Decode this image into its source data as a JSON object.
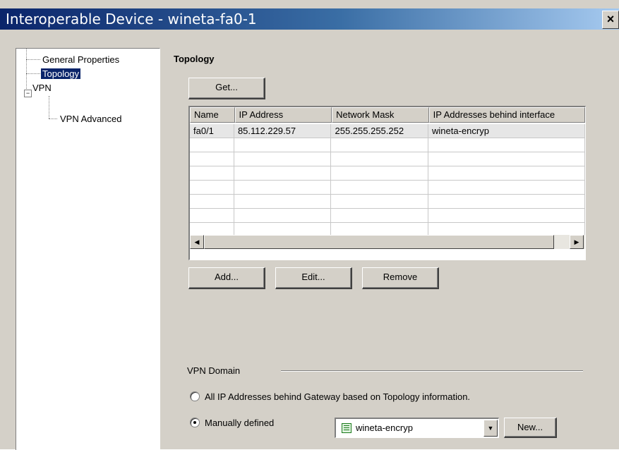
{
  "window": {
    "title": "Interoperable Device - wineta-fa0-1",
    "close_label": "×"
  },
  "tree": {
    "items": [
      {
        "label": "General Properties"
      },
      {
        "label": "Topology",
        "selected": true
      },
      {
        "label": "VPN",
        "expander": "⊟"
      },
      {
        "label": "VPN Advanced"
      }
    ]
  },
  "topology": {
    "title": "Topology",
    "get_label": "Get...",
    "columns": [
      "Name",
      "IP Address",
      "Network Mask",
      "IP Addresses behind interface"
    ],
    "rows": [
      [
        "fa0/1",
        "85.112.229.57",
        "255.255.255.252",
        "wineta-encryp"
      ]
    ],
    "scroll_left": "◀",
    "scroll_right": "▶",
    "add_label": "Add...",
    "edit_label": "Edit...",
    "remove_label": "Remove"
  },
  "vpn_domain": {
    "label": "VPN Domain",
    "option_topology": "All IP Addresses behind Gateway based on Topology information.",
    "option_manual": "Manually defined",
    "selected_option": "manual",
    "combo_value": "wineta-encryp",
    "combo_arrow": "▼",
    "new_label": "New..."
  }
}
